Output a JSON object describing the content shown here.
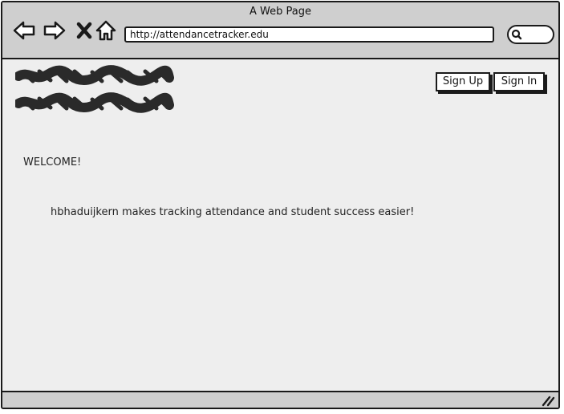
{
  "window": {
    "title": "A Web Page"
  },
  "toolbar": {
    "icons": [
      "back-arrow-icon",
      "forward-arrow-icon",
      "close-x-icon",
      "home-icon",
      "search-icon"
    ],
    "url": "http://attendancetracker.edu"
  },
  "header": {
    "logo": "scribble-logo-placeholder",
    "signup_label": "Sign Up",
    "signin_label": "Sign In"
  },
  "main": {
    "welcome": "WELCOME!",
    "tagline": "hbhaduijkern makes tracking attendance and student success easier!"
  },
  "colors": {
    "chrome": "#cfcfcf",
    "page_background": "#eeeeee",
    "ink": "#1a1a1a"
  }
}
